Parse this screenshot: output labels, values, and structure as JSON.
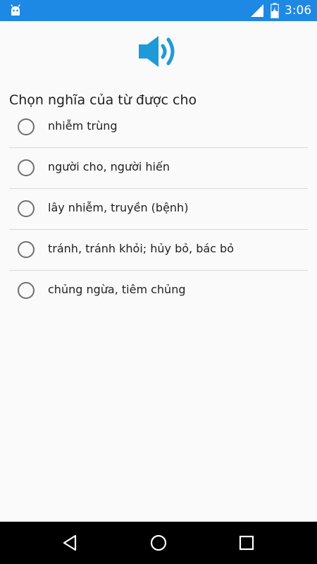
{
  "status_bar": {
    "time": "3:06",
    "icons": [
      "android-icon",
      "signal-icon",
      "battery-charging-icon"
    ],
    "background": "#1e88e5"
  },
  "speaker": {
    "icon": "speaker-volume-icon",
    "color": "#1e9bd7"
  },
  "question": {
    "prompt": "Chọn nghĩa của từ được cho"
  },
  "options": [
    {
      "label": "nhiễm trùng",
      "selected": false
    },
    {
      "label": "người cho, người hiến",
      "selected": false
    },
    {
      "label": "lây nhiễm, truyền (bệnh)",
      "selected": false
    },
    {
      "label": "tránh, tránh khỏi; hủy bỏ, bác bỏ",
      "selected": false
    },
    {
      "label": "chủng ngừa, tiêm chủng",
      "selected": false
    }
  ],
  "nav_bar": {
    "icons": [
      "back-icon",
      "home-icon",
      "recents-icon"
    ]
  }
}
